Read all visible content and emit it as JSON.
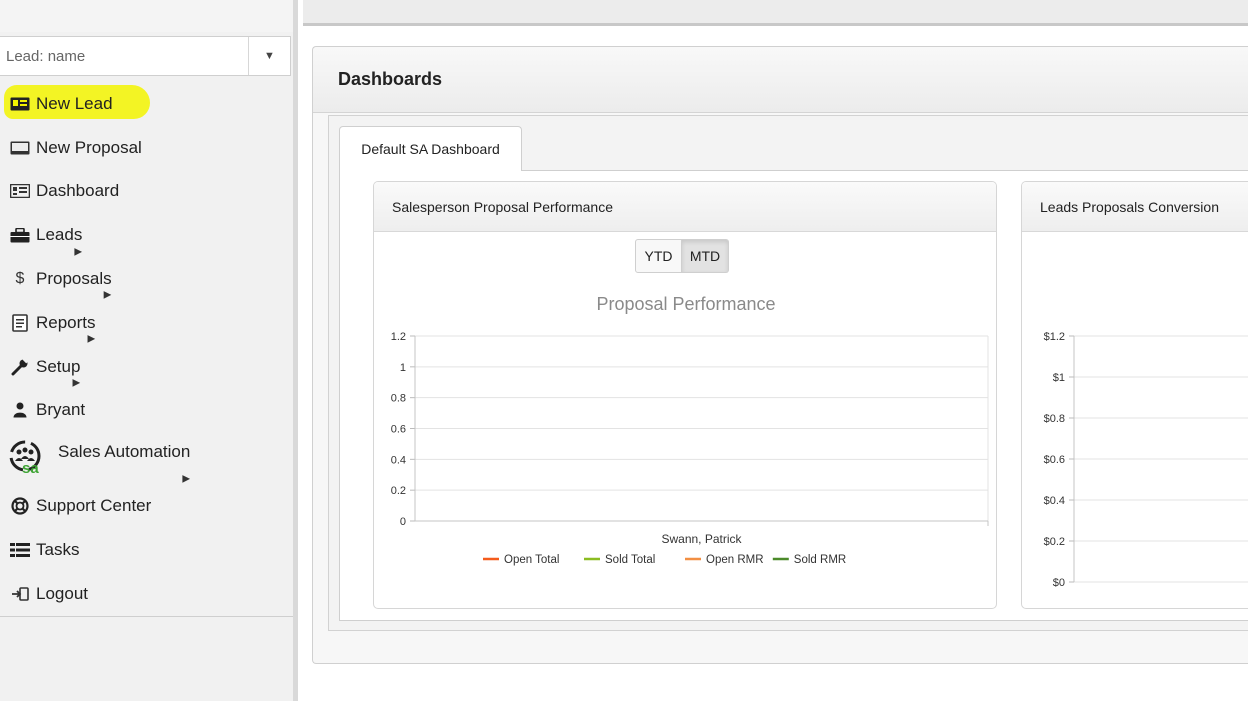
{
  "search": {
    "placeholder": "Lead: name"
  },
  "sidebar": {
    "items": [
      {
        "label": "New Lead",
        "icon": "id-card-icon"
      },
      {
        "label": "New Proposal",
        "icon": "monitor-icon"
      },
      {
        "label": "Dashboard",
        "icon": "dashboard-icon"
      },
      {
        "label": "Leads",
        "icon": "briefcase-icon"
      },
      {
        "label": "Proposals",
        "icon": "dollar-icon"
      },
      {
        "label": "Reports",
        "icon": "document-icon"
      },
      {
        "label": "Setup",
        "icon": "wrench-icon"
      },
      {
        "label": "Bryant",
        "icon": "user-icon"
      },
      {
        "label": "Sales Automation",
        "icon": "sales-automation-logo-icon",
        "logo_text": "sa"
      },
      {
        "label": "Support Center",
        "icon": "lifebuoy-icon"
      },
      {
        "label": "Tasks",
        "icon": "tasks-icon"
      },
      {
        "label": "Logout",
        "icon": "logout-icon"
      }
    ]
  },
  "main": {
    "title": "Dashboards",
    "tab_label": "Default SA Dashboard",
    "card1": {
      "title": "Salesperson Proposal Performance",
      "toggle": [
        "YTD",
        "MTD"
      ]
    },
    "card2": {
      "title": "Leads Proposals Conversion"
    }
  },
  "colors": {
    "highlight": "#f3f400",
    "open_total": "#f45b1c",
    "sold_total": "#8bbc21",
    "open_rmr": "#f28f43",
    "sold_rmr": "#4b8a2a",
    "sa_logo": "#3fa535"
  },
  "chart_data": [
    {
      "type": "line",
      "title": "Proposal Performance",
      "categories": [
        "Swann, Patrick"
      ],
      "y_ticks": [
        "0",
        "0.2",
        "0.4",
        "0.6",
        "0.8",
        "1",
        "1.2"
      ],
      "ylim": [
        0,
        1.2
      ],
      "grid": true,
      "legend_placement": "bottom",
      "series": [
        {
          "name": "Open Total",
          "values": []
        },
        {
          "name": "Sold Total",
          "values": []
        },
        {
          "name": "Open RMR",
          "values": []
        },
        {
          "name": "Sold RMR",
          "values": []
        }
      ]
    },
    {
      "type": "bar",
      "y_ticks": [
        "$0",
        "$0.2",
        "$0.4",
        "$0.6",
        "$0.8",
        "$1",
        "$1.2"
      ],
      "ylim": [
        0,
        1.2
      ],
      "grid": true
    }
  ]
}
